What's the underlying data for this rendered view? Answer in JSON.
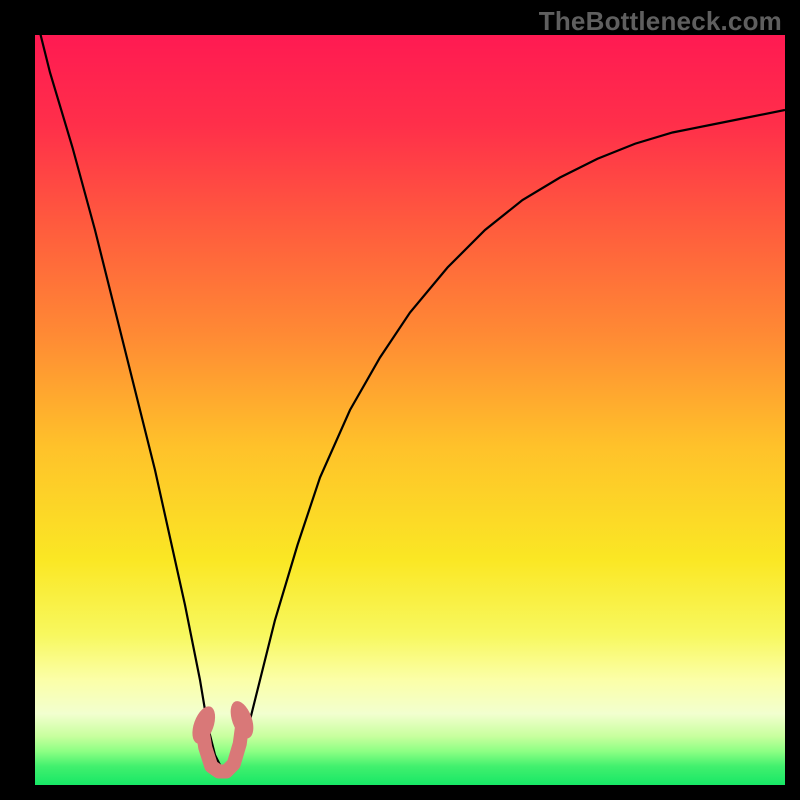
{
  "watermark": "TheBottleneck.com",
  "chart_data": {
    "type": "line",
    "title": "",
    "xlabel": "",
    "ylabel": "",
    "xlim": [
      0,
      100
    ],
    "ylim": [
      0,
      100
    ],
    "x": [
      0,
      2,
      5,
      8,
      10,
      12,
      14,
      16,
      18,
      20,
      22,
      23,
      24,
      25,
      26,
      27,
      28,
      30,
      32,
      35,
      38,
      42,
      46,
      50,
      55,
      60,
      65,
      70,
      75,
      80,
      85,
      90,
      95,
      100
    ],
    "y": [
      103,
      95,
      85,
      74,
      66,
      58,
      50,
      42,
      33,
      24,
      14,
      8,
      4,
      2,
      2,
      3,
      6,
      14,
      22,
      32,
      41,
      50,
      57,
      63,
      69,
      74,
      78,
      81,
      83.5,
      85.5,
      87,
      88,
      89,
      90
    ],
    "minimum_x": 25,
    "minimum_y": 2,
    "gradient_stops": [
      {
        "pos": 0.0,
        "color": "#ff1a52"
      },
      {
        "pos": 0.12,
        "color": "#ff2f4a"
      },
      {
        "pos": 0.25,
        "color": "#ff5a3e"
      },
      {
        "pos": 0.4,
        "color": "#ff8a34"
      },
      {
        "pos": 0.55,
        "color": "#ffc22a"
      },
      {
        "pos": 0.7,
        "color": "#fae724"
      },
      {
        "pos": 0.8,
        "color": "#f8f85f"
      },
      {
        "pos": 0.86,
        "color": "#fbffa8"
      },
      {
        "pos": 0.905,
        "color": "#f2ffcf"
      },
      {
        "pos": 0.935,
        "color": "#c8ff9e"
      },
      {
        "pos": 0.955,
        "color": "#8dff84"
      },
      {
        "pos": 0.975,
        "color": "#42f06e"
      },
      {
        "pos": 1.0,
        "color": "#17e866"
      }
    ],
    "marker": {
      "color": "#d97878",
      "cap_color": "#d97878",
      "points_x": [
        22.3,
        22.7,
        23.5,
        24.5,
        25.5,
        26.5,
        27.3,
        27.7
      ],
      "points_y": [
        7.5,
        5.0,
        2.5,
        1.8,
        1.8,
        2.8,
        5.5,
        8.5
      ]
    }
  }
}
